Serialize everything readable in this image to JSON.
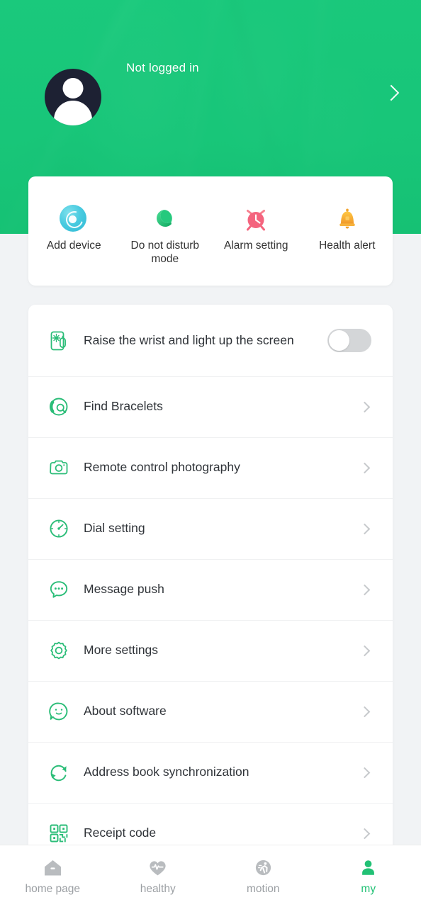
{
  "theme": {
    "brand_green": "#16c172",
    "accent_green": "#22c175",
    "page_bg": "#f1f3f5",
    "card_bg": "#ffffff",
    "text_primary": "#2f3338",
    "text_muted": "#9b9fa3",
    "toggle_off": "#d4d6d8",
    "alarm_pink": "#f4647e",
    "bell_orange": "#f5a623",
    "device_teal": "#49cbe0",
    "avatar_navy": "#1d2133"
  },
  "header": {
    "login_status": "Not logged in",
    "avatar_icon": "user-avatar-icon",
    "chevron_icon": "chevron-right-icon"
  },
  "quick_actions": [
    {
      "label": "Add device",
      "icon": "add-device-icon"
    },
    {
      "label": "Do not disturb\nmode",
      "icon": "moon-icon"
    },
    {
      "label": "Alarm setting",
      "icon": "alarm-clock-icon"
    },
    {
      "label": "Health alert",
      "icon": "bell-icon"
    }
  ],
  "settings_rows": [
    {
      "label": "Raise the wrist and light up the screen",
      "icon": "wrist-raise-screen-icon",
      "control": "toggle",
      "toggle_on": false
    },
    {
      "label": "Find Bracelets",
      "icon": "find-bracelet-icon",
      "control": "chevron"
    },
    {
      "label": "Remote control photography",
      "icon": "camera-icon",
      "control": "chevron"
    },
    {
      "label": "Dial setting",
      "icon": "dial-gauge-icon",
      "control": "chevron"
    },
    {
      "label": "Message push",
      "icon": "chat-bubble-icon",
      "control": "chevron"
    },
    {
      "label": "More settings",
      "icon": "gear-icon",
      "control": "chevron"
    },
    {
      "label": "About software",
      "icon": "smiley-face-icon",
      "control": "chevron"
    },
    {
      "label": "Address book synchronization",
      "icon": "sync-refresh-icon",
      "control": "chevron"
    },
    {
      "label": "Receipt code",
      "icon": "qr-code-icon",
      "control": "chevron"
    }
  ],
  "bottom_nav": {
    "items": [
      {
        "label": "home page",
        "icon": "home-icon",
        "active": false
      },
      {
        "label": "healthy",
        "icon": "heart-pulse-icon",
        "active": false
      },
      {
        "label": "motion",
        "icon": "running-person-icon",
        "active": false
      },
      {
        "label": "my",
        "icon": "person-icon",
        "active": true
      }
    ]
  }
}
